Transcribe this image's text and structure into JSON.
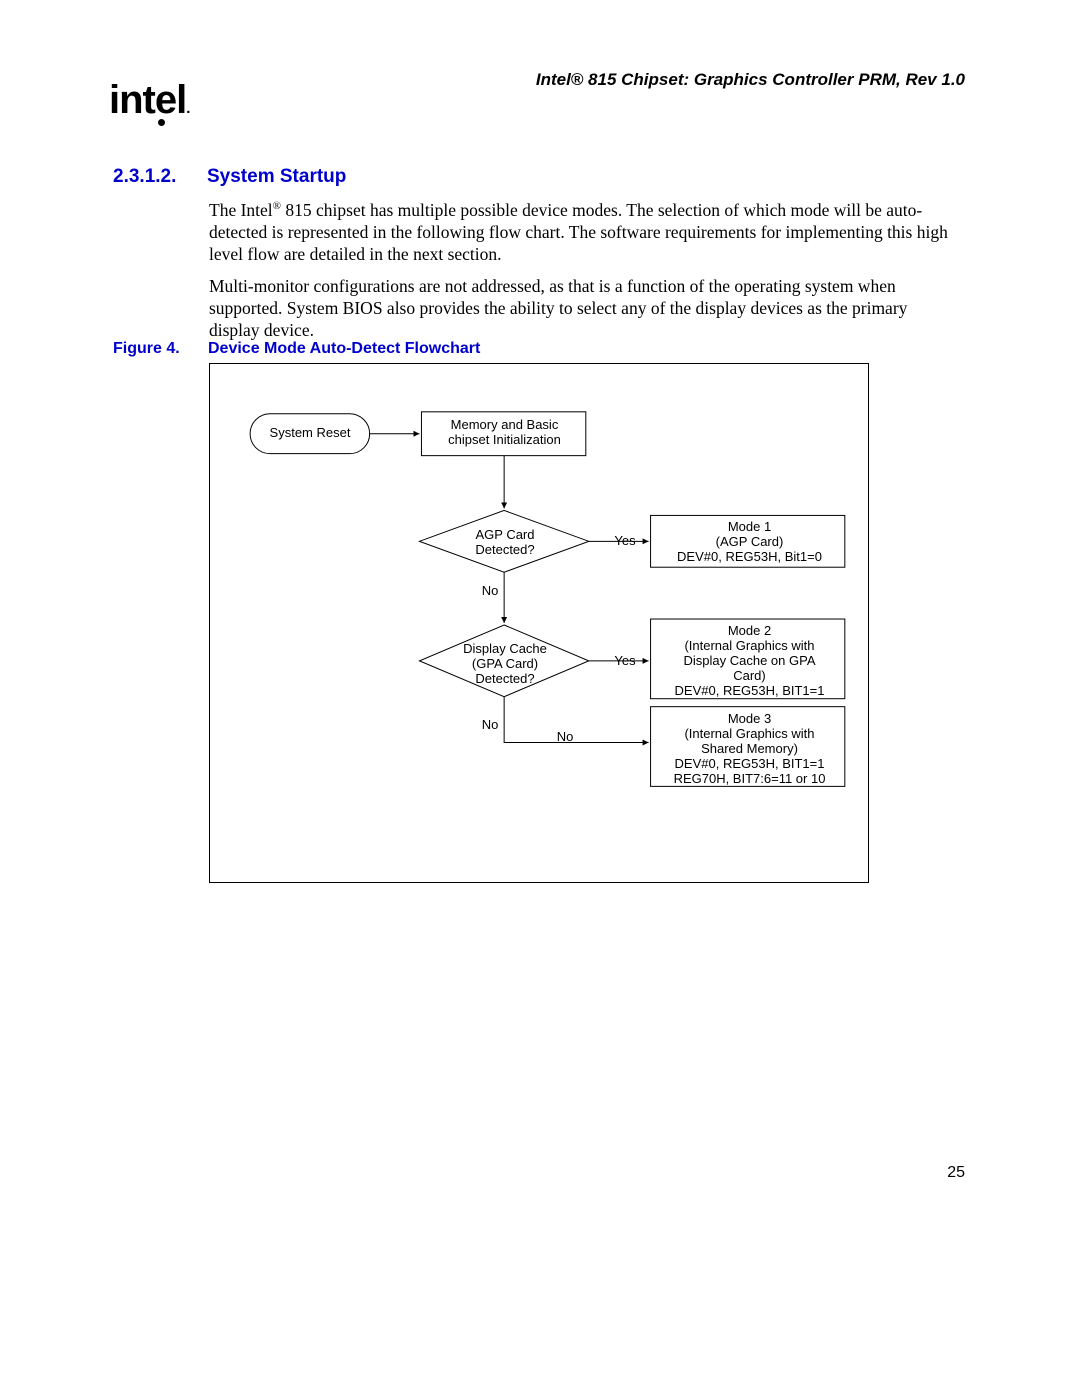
{
  "header": {
    "title": "Intel® 815 Chipset: Graphics Controller PRM, Rev 1.0"
  },
  "logo": {
    "text": "intel"
  },
  "section": {
    "number": "2.3.1.2.",
    "title": "System Startup",
    "para1_a": "The Intel",
    "para1_sup": "®",
    "para1_b": " 815 chipset has multiple possible device modes. The selection of which mode will be auto-detected is represented in the following flow chart. The software requirements for implementing this high level flow are detailed in the next section.",
    "para2": "Multi-monitor configurations are not addressed, as that is a function of the operating system when supported. System BIOS also provides the ability to select any of the display devices as the primary display device."
  },
  "figure": {
    "number": "Figure 4.",
    "title": "Device Mode Auto-Detect Flowchart"
  },
  "flowchart": {
    "start": "System Reset",
    "process1_l1": "Memory and Basic",
    "process1_l2": "chipset Initialization",
    "decision1_l1": "AGP Card",
    "decision1_l2": "Detected?",
    "decision2_l1": "Display Cache",
    "decision2_l2": "(GPA Card)",
    "decision2_l3": "Detected?",
    "mode1_l1": "Mode 1",
    "mode1_l2": "(AGP Card)",
    "mode1_l3": "DEV#0, REG53H, Bit1=0",
    "mode2_l1": "Mode 2",
    "mode2_l2": "(Internal Graphics with",
    "mode2_l3": "Display Cache on GPA",
    "mode2_l4": "Card)",
    "mode2_l5": "DEV#0, REG53H, BIT1=1",
    "mode3_l1": "Mode 3",
    "mode3_l2": "(Internal Graphics with",
    "mode3_l3": "Shared Memory)",
    "mode3_l4": "DEV#0, REG53H, BIT1=1",
    "mode3_l5": "REG70H, BIT7:6=11 or 10",
    "yes": "Yes",
    "no": "No"
  },
  "page": {
    "number": "25"
  }
}
